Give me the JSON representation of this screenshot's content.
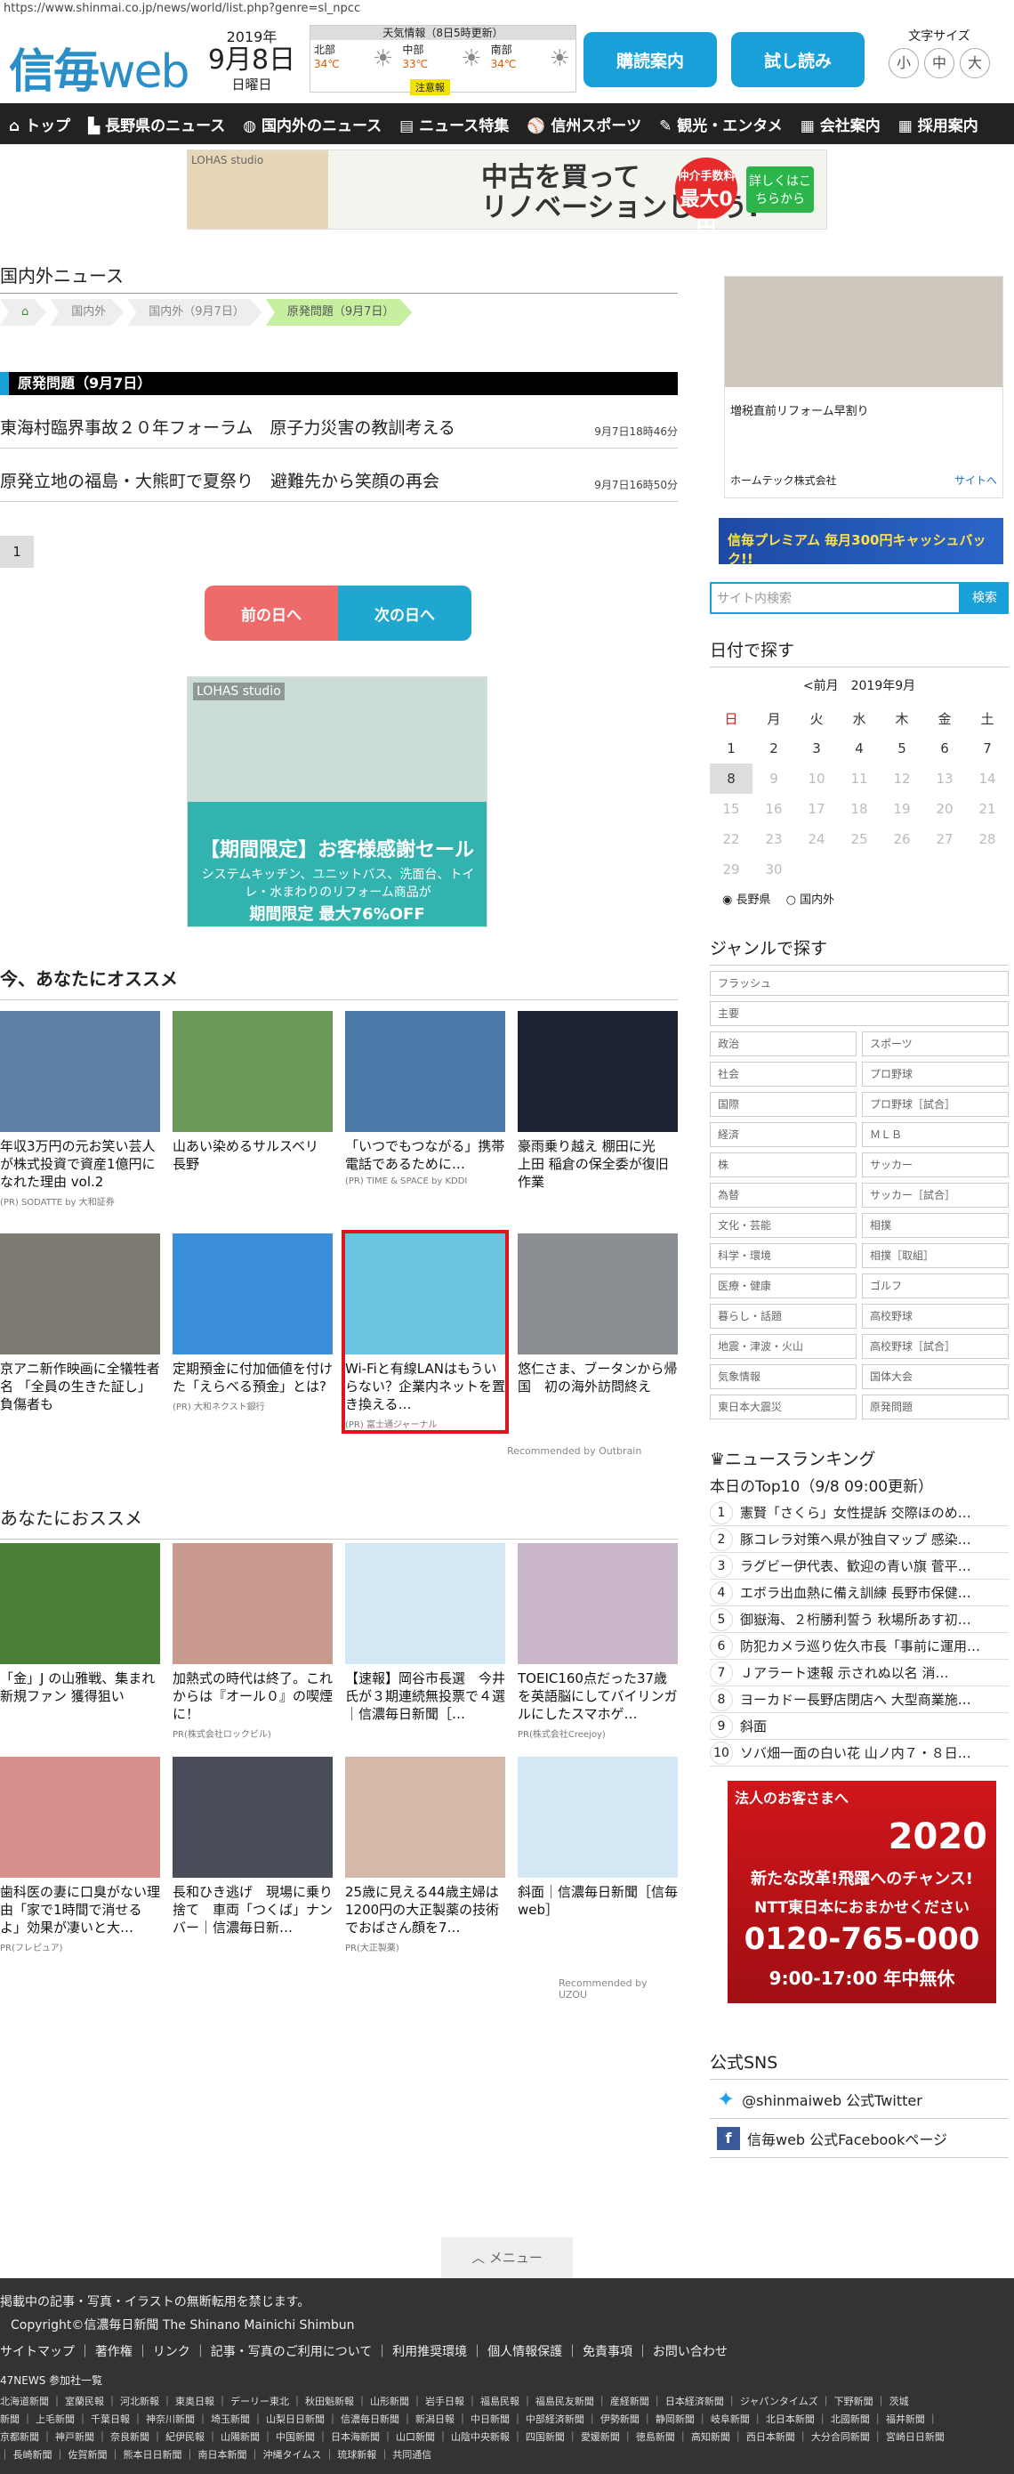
{
  "url": "https://www.shinmai.co.jp/news/world/list.php?genre=sl_npcc",
  "header": {
    "logo_a": "信毎",
    "logo_b": "web",
    "year": "2019年",
    "month_day": "9月8日",
    "weekday": "日曜日",
    "weather_title": "天気情報（8日5時更新）",
    "regions": [
      {
        "name": "北部",
        "temp": "34℃"
      },
      {
        "name": "中部",
        "temp": "33℃"
      },
      {
        "name": "南部",
        "temp": "34℃"
      }
    ],
    "warning": "注意報",
    "subscribe_label": "購読案内",
    "trial_label": "試し読み",
    "font_size_label": "文字サイズ",
    "font_sizes": [
      "小",
      "中",
      "大"
    ]
  },
  "nav": [
    "トップ",
    "長野県のニュース",
    "国内外のニュース",
    "ニュース特集",
    "信州スポーツ",
    "観光・エンタメ",
    "会社案内",
    "採用案内"
  ],
  "top_ad": {
    "label": "LOHAS studio",
    "line1": "中古を買って",
    "line2": "リノベーションしよう!",
    "badge_small": "仲介手数料",
    "badge_big": "最大0円",
    "cta": "詳しくはこちらから"
  },
  "main": {
    "section_title": "国内外ニュース",
    "breadcrumb": [
      "国内外",
      "国内外（9月7日）",
      "原発問題（9月7日）"
    ],
    "genre_title": "原発問題（9月7日）",
    "articles": [
      {
        "title": "東海村臨界事故２０年フォーラム　原子力災害の教訓考える",
        "date": "9月7日18時46分"
      },
      {
        "title": "原発立地の福島・大熊町で夏祭り　避難先から笑顔の再会",
        "date": "9月7日16時50分"
      }
    ],
    "page": "1",
    "prev_label": "前の日へ",
    "next_label": "次の日へ"
  },
  "ad_mid": {
    "brand": "LOHAS studio",
    "line1": "【期間限定】お客様感謝セール",
    "line2": "システムキッチン、ユニットバス、洗面台、トイレ・水まわりのリフォーム商品が",
    "line3": "期間限定 最大76%OFF"
  },
  "recommend": {
    "title": "今、あなたにオススメ",
    "cards": [
      {
        "title": "年収3万円の元お笑い芸人が株式投資で資産1億円になれた理由 vol.2",
        "src": "(PR) SODATTE by 大和証券",
        "color": "#5d7fa6"
      },
      {
        "title": "山あい染めるサルスベリ　長野",
        "src": "",
        "color": "#6a9a5a"
      },
      {
        "title": "「いつでもつながる」携帯電話であるために…",
        "src": "(PR) TIME & SPACE by KDDI",
        "color": "#4a7aa8"
      },
      {
        "title": "豪雨乗り越え 棚田に光　上田 稲倉の保全委が復旧作業",
        "src": "",
        "color": "#1c2433"
      },
      {
        "title": "京アニ新作映画に全犠牲者名 「全員の生きた証し」負傷者も",
        "src": "",
        "color": "#7d7a72"
      },
      {
        "title": "定期預金に付加価値を付けた「えらべる預金」とは?",
        "src": "(PR) 大和ネクスト銀行",
        "color": "#3b8ed8"
      },
      {
        "title": "Wi-Fiと有線LANはもういらない？企業内ネットを置き換える…",
        "src": "(PR) 富士通ジャーナル",
        "color": "#68c4e0"
      },
      {
        "title": "悠仁さま、ブータンから帰国　初の海外訪問終え",
        "src": "",
        "color": "#8a8d92"
      }
    ],
    "credit": "Recommended by Outbrain"
  },
  "recommend2": {
    "title": "あなたにおススメ",
    "cards": [
      {
        "title": "「金」J の山雅戦、集まれ新規ファン 獲得狙い",
        "src": "",
        "color": "#4a7f3a"
      },
      {
        "title": "加熱式の時代は終了。これからは『オール０』の喫煙に！",
        "src": "PR(株式会社ロックビル)",
        "color": "#c99a8e"
      },
      {
        "title": "【速報】岡谷市長選　今井氏が３期連続無投票で４選｜信濃毎日新聞［…",
        "src": "",
        "color": "#d3e8f4"
      },
      {
        "title": "TOEIC160点だった37歳を英語脳にしてバイリンガルにしたスマホゲ…",
        "src": "PR(株式会社Creejoy)",
        "color": "#c9b6c8"
      },
      {
        "title": "歯科医の妻に口臭がない理由「家で1時間で消せるよ」効果が凄いと大…",
        "src": "PR(フレピュア)",
        "color": "#d88e8a"
      },
      {
        "title": "長和ひき逃げ　現場に乗り捨て　車両「つくば」ナンバー｜信濃毎日新…",
        "src": "",
        "color": "#4a4e5a"
      },
      {
        "title": "25歳に見える44歳主婦は1200円の大正製薬の技術でおばさん顔を7…",
        "src": "PR(大正製薬)",
        "color": "#d4b9a8"
      },
      {
        "title": "斜面｜信濃毎日新聞［信毎web］",
        "src": "",
        "color": "#d3e8f4"
      }
    ],
    "credit": "Recommended by UZOU"
  },
  "side": {
    "ad_caption": "増税直前リフォーム早割り",
    "ad_company": "ホームテック株式会社",
    "ad_link": "サイトへ",
    "premium_text": "信毎プレミアム 毎月300円キャッシュバック!!",
    "search_placeholder": "サイト内検索",
    "search_button": "検索",
    "date_title": "日付で探す",
    "cal_prev": "<前月",
    "cal_month": "2019年9月",
    "weekdays": [
      "日",
      "月",
      "火",
      "水",
      "木",
      "金",
      "土"
    ],
    "cal_rows": [
      [
        "1",
        "2",
        "3",
        "4",
        "5",
        "6",
        "7"
      ],
      [
        "8",
        "9",
        "10",
        "11",
        "12",
        "13",
        "14"
      ],
      [
        "15",
        "16",
        "17",
        "18",
        "19",
        "20",
        "21"
      ],
      [
        "22",
        "23",
        "24",
        "25",
        "26",
        "27",
        "28"
      ],
      [
        "29",
        "30",
        "",
        "",
        "",
        "",
        ""
      ]
    ],
    "radio_a": "長野県",
    "radio_b": "国内外",
    "genre_title": "ジャンルで探す",
    "genres_full": [
      "フラッシュ",
      "主要"
    ],
    "genres": [
      "政治",
      "スポーツ",
      "社会",
      "プロ野球",
      "国際",
      "プロ野球［試合］",
      "経済",
      "ＭＬＢ",
      "株",
      "サッカー",
      "為替",
      "サッカー［試合］",
      "文化・芸能",
      "相撲",
      "科学・環境",
      "相撲［取組］",
      "医療・健康",
      "ゴルフ",
      "暮らし・話題",
      "高校野球",
      "地震・津波・火山",
      "高校野球［試合］",
      "気象情報",
      "国体大会",
      "東日本大震災",
      "原発問題"
    ],
    "ranking_title": "ニュースランキング",
    "ranking_sub": "本日のTop10（9/8 09:00更新）",
    "ranking": [
      "憲賢「さくら」女性提訴 交際ほのめ…",
      "豚コレラ対策へ県が独自マップ 感染…",
      "ラグビー伊代表、歓迎の青い旗 菅平…",
      "エボラ出血熱に備え訓練 長野市保健…",
      "御嶽海、２桁勝利誓う 秋場所あす初…",
      "防犯カメラ巡り佐久市長「事前に運用…",
      "Ｊアラート速報 示されぬ以名 消…",
      "ヨーカドー長野店閉店へ 大型商業施…",
      "斜面",
      "ソバ畑一面の白い花 山ノ内７・８日…"
    ],
    "ad3_l1": "法人のお客さまへ",
    "ad3_l2": "2020",
    "ad3_l3": "新たな改革!飛躍へのチャンス!",
    "ad3_l4": "NTT東日本におまかせください",
    "ad3_tel": "0120-765-000",
    "ad3_hours": "9:00-17:00 年中無休",
    "sns_title": "公式SNS",
    "sns_twitter": "@shinmaiweb 公式Twitter",
    "sns_facebook": "信毎web 公式Facebookページ"
  },
  "footer": {
    "menu": "メニュー",
    "notice": "掲載中の記事・写真・イラストの無断転用を禁じます。",
    "copyright": "Copyright©信濃毎日新聞 The Shinano Mainichi Shimbun",
    "links": "サイトマップ ｜ 著作権 ｜ リンク ｜ 記事・写真のご利用について ｜ 利用推奨環境 ｜ 個人情報保護 ｜ 免責事項 ｜ お問い合わせ",
    "news47": "47NEWS 参加社一覧",
    "papers1": "北海道新聞 ｜ 室蘭民報 ｜ 河北新報 ｜ 東奥日報 ｜ デーリー東北 ｜ 秋田魁新報 ｜ 山形新聞 ｜ 岩手日報 ｜ 福島民報 ｜ 福島民友新聞 ｜ 産経新聞 ｜ 日本経済新聞 ｜ ジャパンタイムズ ｜ 下野新聞 ｜ 茨城",
    "papers2": "新聞 ｜ 上毛新聞 ｜ 千葉日報 ｜ 神奈川新聞 ｜ 埼玉新聞 ｜ 山梨日日新聞 ｜ 信濃毎日新聞 ｜ 新潟日報 ｜ 中日新聞 ｜ 中部経済新聞 ｜ 伊勢新聞 ｜ 静岡新聞 ｜ 岐阜新聞 ｜ 北日本新聞 ｜ 北國新聞 ｜ 福井新聞 ｜",
    "papers3": "京都新聞 ｜ 神戸新聞 ｜ 奈良新聞 ｜ 紀伊民報 ｜ 山陽新聞 ｜ 中国新聞 ｜ 日本海新聞 ｜ 山口新聞 ｜ 山陰中央新報 ｜ 四国新聞 ｜ 愛媛新聞 ｜ 徳島新聞 ｜ 高知新聞 ｜ 西日本新聞 ｜ 大分合同新聞 ｜ 宮崎日日新聞",
    "papers4": "｜ 長崎新聞 ｜ 佐賀新聞 ｜ 熊本日日新聞 ｜ 南日本新聞 ｜ 沖縄タイムス ｜ 琉球新報 ｜ 共同通信"
  }
}
